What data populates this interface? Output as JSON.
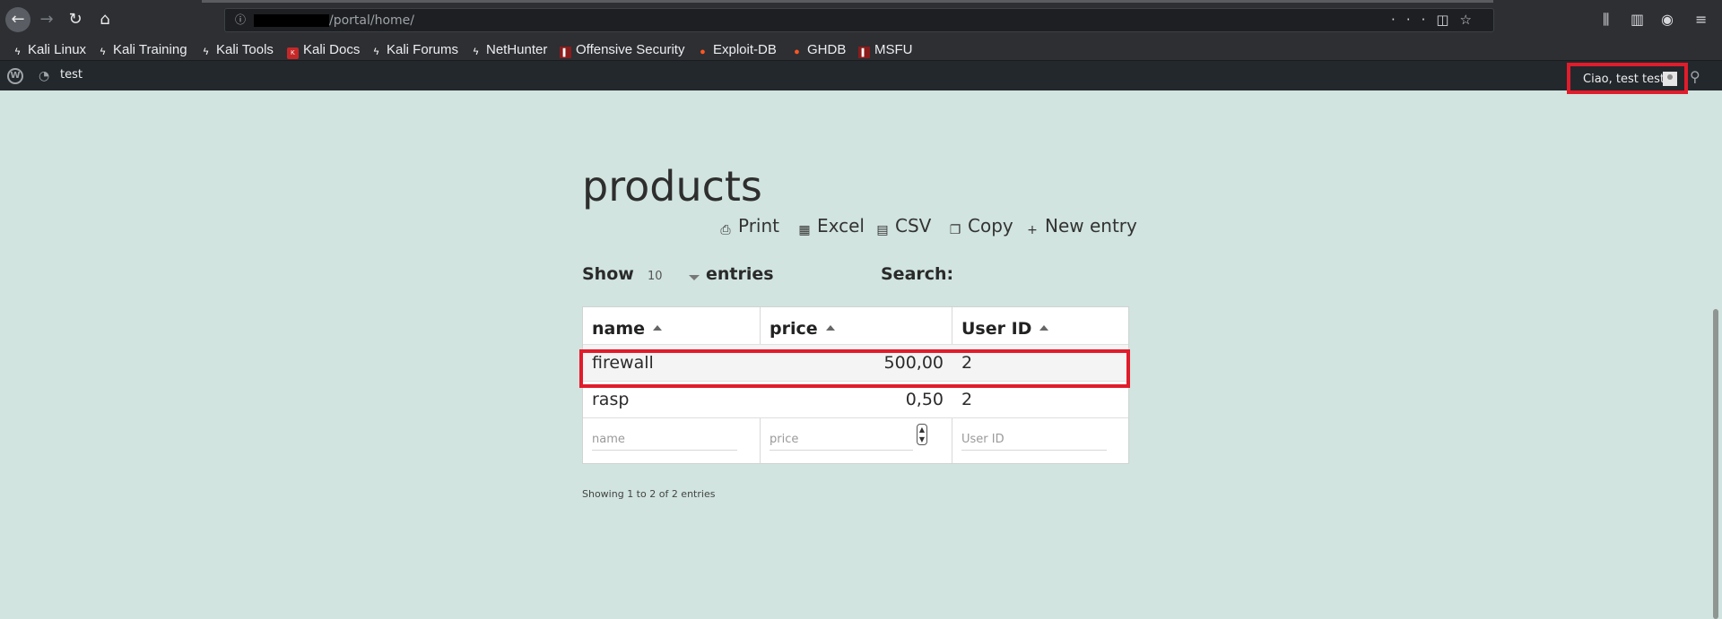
{
  "browser": {
    "url_path": "/portal/home/",
    "bookmarks": [
      "Kali Linux",
      "Kali Training",
      "Kali Tools",
      "Kali Docs",
      "Kali Forums",
      "NetHunter",
      "Offensive Security",
      "Exploit-DB",
      "GHDB",
      "MSFU"
    ]
  },
  "adminbar": {
    "site_name": "test",
    "greeting": "Ciao, test test"
  },
  "page": {
    "title": "products",
    "actions": {
      "print": "Print",
      "excel": "Excel",
      "csv": "CSV",
      "copy": "Copy",
      "new_entry": "New entry"
    },
    "show_label": "Show",
    "page_length": "10",
    "entries_label": "entries",
    "search_label": "Search:",
    "table": {
      "headers": [
        "name",
        "price",
        "User ID"
      ],
      "rows": [
        [
          "firewall",
          "500,00",
          "2"
        ],
        [
          "rasp",
          "0,50",
          "2"
        ]
      ],
      "filter_placeholders": [
        "name",
        "price",
        "User ID"
      ]
    },
    "info": "Showing 1 to 2 of 2 entries"
  },
  "colors": {
    "highlight": "#e11c2b",
    "page_bg": "#d1e4df",
    "adminbar_bg": "#23282d"
  }
}
